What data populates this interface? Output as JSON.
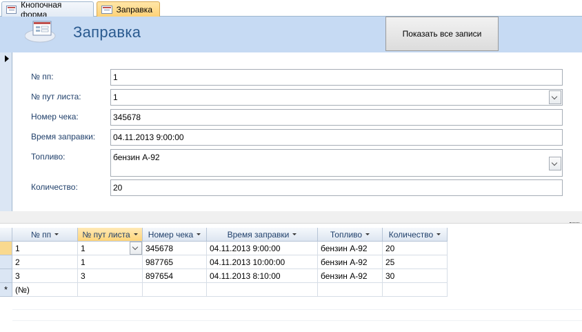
{
  "tabs": [
    {
      "label": "Кнопочная форма",
      "icon": "form-icon"
    },
    {
      "label": "Заправка",
      "icon": "form-icon",
      "active": true
    }
  ],
  "header": {
    "title": "Заправка",
    "show_all_button": "Показать все записи"
  },
  "form": {
    "fields": [
      {
        "label": "№ пп:",
        "value": "1"
      },
      {
        "label": "№ пут листа:",
        "value": "1"
      },
      {
        "label": "Номер чека:",
        "value": "345678"
      },
      {
        "label": "Время заправки:",
        "value": "04.11.2013 9:00:00"
      },
      {
        "label": "Топливо:",
        "value": "бензин А-92"
      },
      {
        "label": "Количество:",
        "value": "20"
      }
    ]
  },
  "datasheet": {
    "columns": [
      "№ пп",
      "№ пут листа",
      "Номер чека",
      "Время заправки",
      "Топливо",
      "Количество"
    ],
    "rows": [
      [
        "1",
        "1",
        "345678",
        "04.11.2013 9:00:00",
        "бензин А-92",
        "20"
      ],
      [
        "2",
        "1",
        "987765",
        "04.11.2013 10:00:00",
        "бензин А-92",
        "25"
      ],
      [
        "3",
        "3",
        "897654",
        "04.11.2013 8:10:00",
        "бензин А-92",
        "30"
      ]
    ],
    "new_row_marker": "*",
    "new_row_value": "(№)"
  },
  "colors": {
    "header_bg": "#c6daf3",
    "title_color": "#2a5a8f",
    "active_tab": "#ffd277"
  }
}
